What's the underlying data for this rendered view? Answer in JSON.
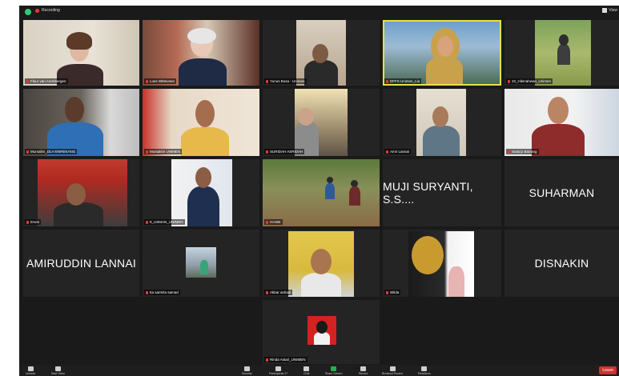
{
  "meeting": {
    "recording_label": "Recording",
    "view_label": "View"
  },
  "participants": [
    {
      "name": "Fleur van Arembergen",
      "display": "video"
    },
    {
      "name": "Loes Witteveen",
      "display": "video"
    },
    {
      "name": "Yunus Busa - Unimen",
      "display": "video"
    },
    {
      "name": "DFFS Unimen_Lia",
      "display": "video",
      "active_speaker": true
    },
    {
      "name": "10_Hikmahwan_Unimen",
      "display": "video"
    },
    {
      "name": "Mursalim_DLH ENREKANG",
      "display": "video"
    },
    {
      "name": "Mustakim UNIMEN",
      "display": "video"
    },
    {
      "name": "SURIDAH ASRIDAH",
      "display": "video"
    },
    {
      "name": "Amir Lannai",
      "display": "video"
    },
    {
      "name": "Sutarjo Barrang",
      "display": "video"
    },
    {
      "name": "Erwin",
      "display": "video"
    },
    {
      "name": "9_USMAN_UNIMEN",
      "display": "video"
    },
    {
      "name": "HASBI",
      "display": "video"
    },
    {
      "name": "MUJI SURYANTI, S.S....",
      "display": "name"
    },
    {
      "name": "SUHARMAN",
      "display": "name"
    },
    {
      "name": "AMIRUDDIN LANNAI",
      "display": "name"
    },
    {
      "name": "Ita sarmita samad",
      "display": "video"
    },
    {
      "name": "Akbar ashadi",
      "display": "video"
    },
    {
      "name": "Wilda",
      "display": "video"
    },
    {
      "name": "DISNAKIN",
      "display": "name"
    },
    {
      "name": "Rinda Astari_UNIMEN",
      "display": "video"
    }
  ],
  "toolbar": {
    "unmute": "Unmute",
    "start_video": "Start Video",
    "security": "Security",
    "participants": "Participants",
    "participants_count": "27",
    "chat": "Chat",
    "share_screen": "Share Screen",
    "record": "Record",
    "breakout_rooms": "Breakout Rooms",
    "reactions": "Reactions",
    "leave": "Leave"
  },
  "colors": {
    "active_speaker_border": "#e6e04a",
    "recording_dot": "#e53935",
    "leave_button": "#d32f2f",
    "share_button": "#22b14c"
  }
}
